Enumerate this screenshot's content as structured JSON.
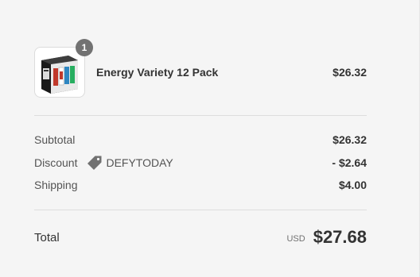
{
  "product": {
    "name": "Energy Variety 12 Pack",
    "price": "$26.32",
    "quantity": "1",
    "image_icon": "product-box-thumbnail"
  },
  "summary": {
    "subtotal_label": "Subtotal",
    "subtotal_value": "$26.32",
    "discount_label": "Discount",
    "discount_code": "DEFYTODAY",
    "discount_icon": "tag-icon",
    "discount_value": "- $2.64",
    "shipping_label": "Shipping",
    "shipping_value": "$4.00"
  },
  "total": {
    "label": "Total",
    "currency": "USD",
    "value": "$27.68"
  },
  "colors": {
    "background": "#f5f5f5",
    "badge": "#727272",
    "text": "#333333",
    "muted": "#545454"
  }
}
